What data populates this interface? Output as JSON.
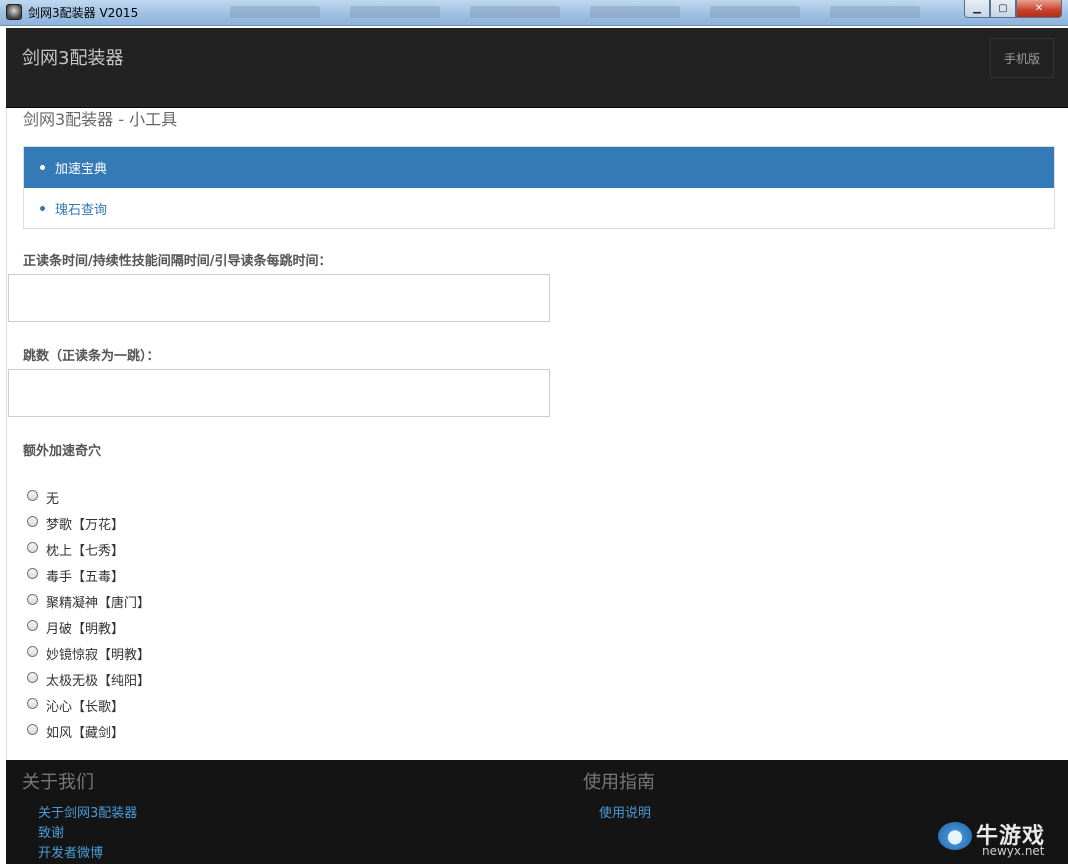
{
  "window": {
    "title": "剑网3配装器 V2015",
    "minimize_glyph": "▁",
    "maximize_glyph": "▢",
    "close_glyph": "✕"
  },
  "navbar": {
    "brand": "剑网3配装器",
    "mobile_label": "手机版"
  },
  "page": {
    "heading": "剑网3配装器 - 小工具"
  },
  "menu": {
    "items": [
      {
        "label": "加速宝典",
        "active": true
      },
      {
        "label": "瑰石查询",
        "active": false
      }
    ]
  },
  "form": {
    "field1_label": "正读条时间/持续性技能间隔时间/引导读条每跳时间：",
    "field1_value": "",
    "field2_label": "跳数（正读条为一跳）：",
    "field2_value": "",
    "radio_group_label": "额外加速奇穴",
    "radios": [
      "无",
      "梦歌【万花】",
      "枕上【七秀】",
      "毒手【五毒】",
      "聚精凝神【唐门】",
      "月破【明教】",
      "妙镜惊寂【明教】",
      "太极无极【纯阳】",
      "沁心【长歌】",
      "如风【藏剑】"
    ]
  },
  "footer": {
    "about_heading": "关于我们",
    "about_links": [
      "关于剑网3配装器",
      "致谢",
      "开发者微博"
    ],
    "guide_heading": "使用指南",
    "guide_links": [
      "使用说明"
    ]
  },
  "watermark": {
    "brand": "牛游戏",
    "url": "newyx.net"
  },
  "colors": {
    "accent": "#337ab7",
    "navbar_bg": "#222222",
    "footer_bg": "#141414",
    "link": "#4a9bd8"
  },
  "icons": {
    "app": "app-icon",
    "watermark": "cow-logo-icon"
  }
}
